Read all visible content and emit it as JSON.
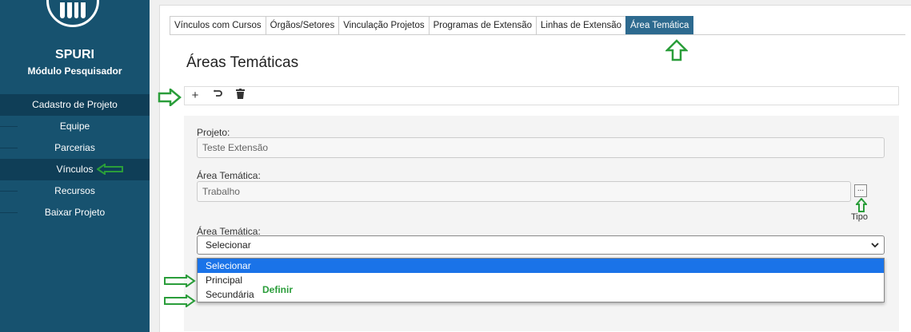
{
  "colors": {
    "sidebar": "#17526f",
    "sidebar_active": "#0f3e57",
    "tab_active": "#2d6a8f",
    "annotation_green": "#2a9d3a",
    "option_highlight": "#1a73e8"
  },
  "sidebar": {
    "app_name": "SPURI",
    "app_subtitle": "Módulo Pesquisador",
    "section_header": "Cadastro de Projeto",
    "items": [
      {
        "label": "Equipe"
      },
      {
        "label": "Parcerias"
      },
      {
        "label": "Vínculos"
      },
      {
        "label": "Recursos"
      },
      {
        "label": "Baixar Projeto"
      }
    ]
  },
  "tabs": [
    {
      "label": "Vínculos com Cursos"
    },
    {
      "label": "Órgãos/Setores"
    },
    {
      "label": "Vinculação Projetos"
    },
    {
      "label": "Programas de Extensão"
    },
    {
      "label": "Linhas de Extensão"
    },
    {
      "label": "Área Temática",
      "active": true
    }
  ],
  "page_title": "Áreas Temáticas",
  "toolbar": {
    "add_icon": "plus-icon",
    "undo_icon": "undo-icon",
    "delete_icon": "trash-icon"
  },
  "form": {
    "projeto_label": "Projeto:",
    "projeto_value": "Teste Extensão",
    "area_label": "Área Temática:",
    "area_value": "Trabalho",
    "lookup_button": "...",
    "tipo_label": "Tipo",
    "area_select_label": "Área Temática:",
    "area_select_value": "Selecionar",
    "options": [
      "Selecionar",
      "Principal",
      "Secundária"
    ]
  },
  "annotation": {
    "definir": "Definir"
  }
}
